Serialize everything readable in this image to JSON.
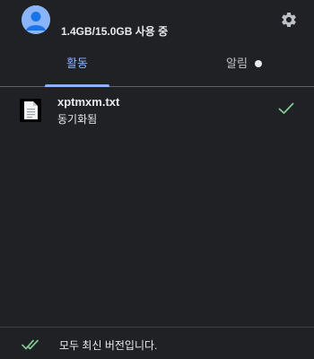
{
  "header": {
    "storage_text": "1.4GB/15.0GB 사용 중",
    "avatar_icon": "avatar-icon",
    "settings_icon": "gear-icon"
  },
  "tabs": [
    {
      "label": "활동",
      "active": true
    },
    {
      "label": "알림",
      "active": false,
      "has_dot": true
    }
  ],
  "files": [
    {
      "name": "xptmxm.txt",
      "status": "동기화됨",
      "icon": "text-file-icon",
      "status_icon": "check-icon"
    }
  ],
  "footer": {
    "text": "모두 최신 버전입니다.",
    "icon": "double-check-icon"
  },
  "colors": {
    "background": "#202124",
    "accent": "#8ab4f8",
    "check": "#81c995"
  }
}
